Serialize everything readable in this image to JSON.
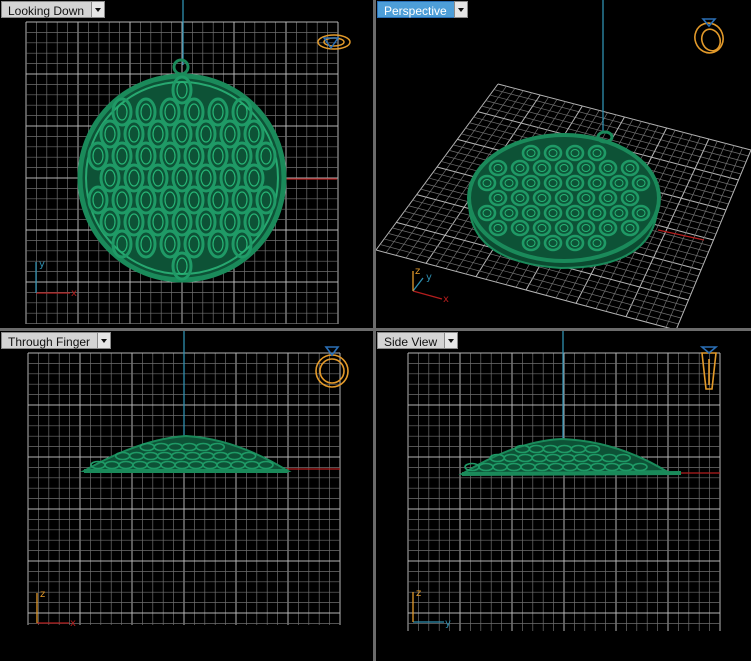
{
  "viewports": {
    "top_left": {
      "label": "Looking Down"
    },
    "top_right": {
      "label": "Perspective"
    },
    "bottom_left": {
      "label": "Through Finger"
    },
    "bottom_right": {
      "label": "Side View"
    }
  },
  "axis_letters": {
    "x": "x",
    "y": "y",
    "z": "z"
  },
  "colors": {
    "model": "#1a8a5a",
    "grid": "#8f8f8f",
    "grid_major": "#c8c8c8",
    "axis_red": "#b31d1d",
    "axis_blue": "#2f8fb0",
    "widget": "#e39a2a",
    "active_tab": "#4d9ed8"
  },
  "icons": {
    "top_left": "ring-top-icon",
    "top_right": "ring-perspective-icon",
    "bottom_left": "ring-front-icon",
    "bottom_right": "ring-side-icon"
  }
}
